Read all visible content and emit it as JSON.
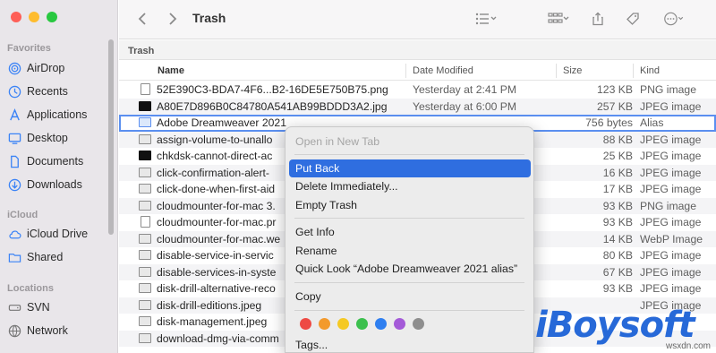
{
  "window": {
    "title": "Trash",
    "traffic_lights": [
      "#fe5f57",
      "#febc2e",
      "#28c840"
    ]
  },
  "sidebar": {
    "sections": [
      {
        "title": "Favorites",
        "items": [
          {
            "label": "AirDrop",
            "icon": "airdrop-icon"
          },
          {
            "label": "Recents",
            "icon": "clock-icon"
          },
          {
            "label": "Applications",
            "icon": "applications-icon"
          },
          {
            "label": "Desktop",
            "icon": "desktop-icon"
          },
          {
            "label": "Documents",
            "icon": "document-icon"
          },
          {
            "label": "Downloads",
            "icon": "download-icon"
          }
        ]
      },
      {
        "title": "iCloud",
        "items": [
          {
            "label": "iCloud Drive",
            "icon": "cloud-icon"
          },
          {
            "label": "Shared",
            "icon": "shared-folder-icon"
          }
        ]
      },
      {
        "title": "Locations",
        "items": [
          {
            "label": "SVN",
            "icon": "drive-icon"
          },
          {
            "label": "Network",
            "icon": "globe-icon"
          }
        ]
      }
    ]
  },
  "pathbar": {
    "label": "Trash"
  },
  "columns": {
    "name": "Name",
    "date": "Date Modified",
    "size": "Size",
    "kind": "Kind"
  },
  "files": [
    {
      "name": "52E390C3-BDA7-4F6...B2-16DE5E750B75.png",
      "date": "Yesterday at 2:41 PM",
      "size": "123 KB",
      "kind": "PNG image",
      "icon": "doc"
    },
    {
      "name": "A80E7D896B0C84780A541AB99BDDD3A2.jpg",
      "date": "Yesterday at 6:00 PM",
      "size": "257 KB",
      "kind": "JPEG image",
      "icon": "dark"
    },
    {
      "name": "Adobe Dreamweaver 2021",
      "date": "",
      "size": "756 bytes",
      "kind": "Alias",
      "icon": "alias"
    },
    {
      "name": "assign-volume-to-unallo",
      "date": "",
      "size": "88 KB",
      "kind": "JPEG image",
      "icon": "img"
    },
    {
      "name": "chkdsk-cannot-direct-ac",
      "date": "",
      "size": "25 KB",
      "kind": "JPEG image",
      "icon": "dark"
    },
    {
      "name": "click-confirmation-alert-",
      "date": "",
      "size": "16 KB",
      "kind": "JPEG image",
      "icon": "img"
    },
    {
      "name": "click-done-when-first-aid",
      "date": "",
      "size": "17 KB",
      "kind": "JPEG image",
      "icon": "img"
    },
    {
      "name": "cloudmounter-for-mac 3.",
      "date": "",
      "size": "93 KB",
      "kind": "PNG image",
      "icon": "img"
    },
    {
      "name": "cloudmounter-for-mac.pr",
      "date": "",
      "size": "93 KB",
      "kind": "JPEG image",
      "icon": "doc"
    },
    {
      "name": "cloudmounter-for-mac.we",
      "date": "",
      "size": "14 KB",
      "kind": "WebP Image",
      "icon": "img"
    },
    {
      "name": "disable-service-in-servic",
      "date": "",
      "size": "80 KB",
      "kind": "JPEG image",
      "icon": "img"
    },
    {
      "name": "disable-services-in-syste",
      "date": "",
      "size": "67 KB",
      "kind": "JPEG image",
      "icon": "img"
    },
    {
      "name": "disk-drill-alternative-reco",
      "date": "",
      "size": "93 KB",
      "kind": "JPEG image",
      "icon": "img"
    },
    {
      "name": "disk-drill-editions.jpeg",
      "date": "",
      "size": "",
      "kind": "JPEG image",
      "icon": "img"
    },
    {
      "name": "disk-management.jpeg",
      "date": "",
      "size": "",
      "kind": "",
      "icon": "img"
    },
    {
      "name": "download-dmg-via-comm",
      "date": "",
      "size": "",
      "kind": "",
      "icon": "img"
    }
  ],
  "context_menu": {
    "items": [
      {
        "label": "Open in New Tab",
        "disabled": true,
        "highlighted": false
      },
      {
        "label": "Put Back",
        "disabled": false,
        "highlighted": true
      },
      {
        "label": "Delete Immediately...",
        "disabled": false,
        "highlighted": false
      },
      {
        "label": "Empty Trash",
        "disabled": false,
        "highlighted": false
      },
      {
        "label": "Get Info",
        "disabled": false,
        "highlighted": false
      },
      {
        "label": "Rename",
        "disabled": false,
        "highlighted": false
      },
      {
        "label": "Quick Look “Adobe Dreamweaver 2021 alias”",
        "disabled": false,
        "highlighted": false
      },
      {
        "label": "Copy",
        "disabled": false,
        "highlighted": false
      },
      {
        "label": "Tags...",
        "disabled": false,
        "highlighted": false
      }
    ],
    "tag_colors": [
      "#ee4a44",
      "#f39a2c",
      "#f5c923",
      "#3cc04e",
      "#2f7ff0",
      "#a45ad8",
      "#8e8e8e"
    ]
  },
  "watermark": {
    "brand": "iBoysoft",
    "site": "wsxdn.com"
  },
  "accent": "#2f6ee0",
  "arrow_color": "#e5473c"
}
